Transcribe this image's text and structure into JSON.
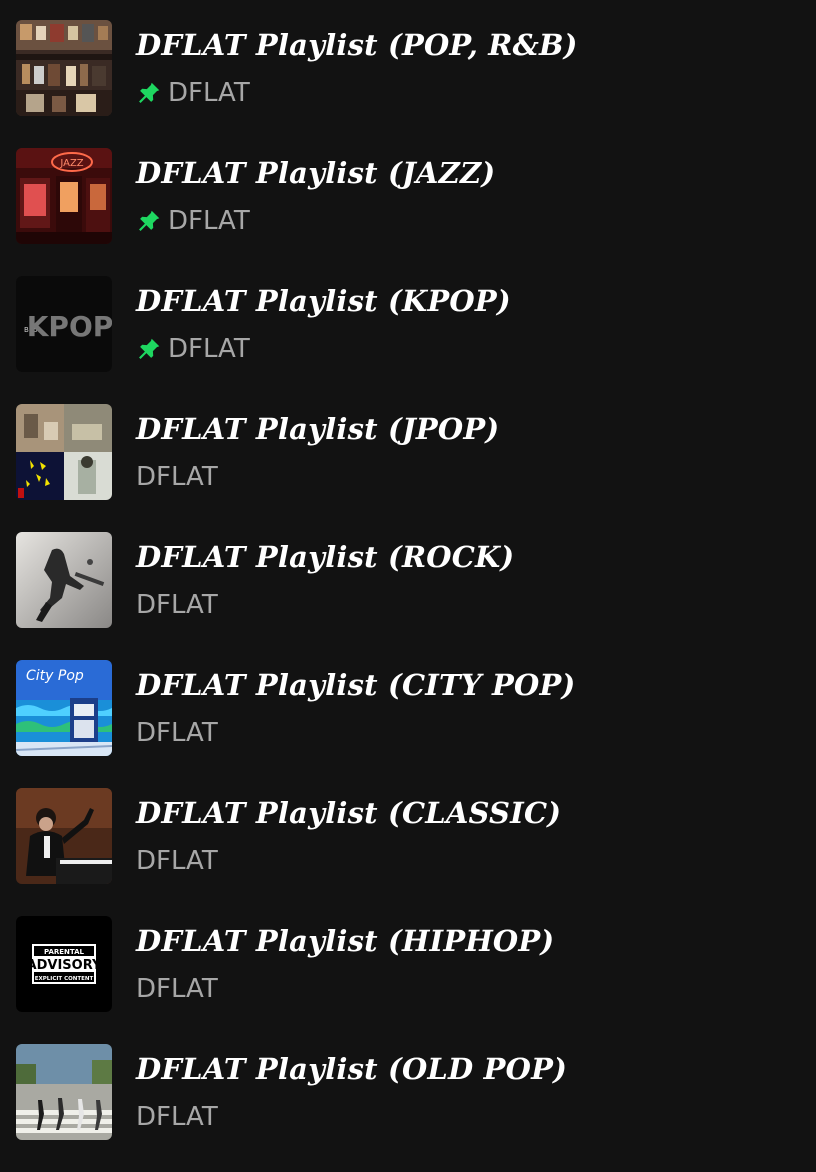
{
  "colors": {
    "background": "#121212",
    "title": "#ffffff",
    "subtitle": "#a7a7a7",
    "pin": "#1ed760"
  },
  "playlists": [
    {
      "title": "DFLAT Playlist (POP, R&B)",
      "owner": "DFLAT",
      "pinned": true,
      "cover_icon": "record-store-cover"
    },
    {
      "title": "DFLAT Playlist (JAZZ)",
      "owner": "DFLAT",
      "pinned": true,
      "cover_icon": "jazz-bar-cover",
      "cover_text": "JAZZ"
    },
    {
      "title": "DFLAT Playlist (KPOP)",
      "owner": "DFLAT",
      "pinned": true,
      "cover_icon": "kpop-text-cover",
      "cover_text": "KPOP",
      "cover_subtext": "B15"
    },
    {
      "title": "DFLAT Playlist (JPOP)",
      "owner": "DFLAT",
      "pinned": false,
      "cover_icon": "jpop-collage-cover"
    },
    {
      "title": "DFLAT Playlist (ROCK)",
      "owner": "DFLAT",
      "pinned": false,
      "cover_icon": "rock-guitarist-cover"
    },
    {
      "title": "DFLAT Playlist (CITY POP)",
      "owner": "DFLAT",
      "pinned": false,
      "cover_icon": "city-pop-cover",
      "cover_text": "City Pop"
    },
    {
      "title": "DFLAT Playlist (CLASSIC)",
      "owner": "DFLAT",
      "pinned": false,
      "cover_icon": "pianist-cover"
    },
    {
      "title": "DFLAT Playlist (HIPHOP)",
      "owner": "DFLAT",
      "pinned": false,
      "cover_icon": "parental-advisory-cover",
      "cover_text": [
        "PARENTAL",
        "ADVISORY",
        "EXPLICIT CONTENT"
      ]
    },
    {
      "title": "DFLAT Playlist (OLD POP)",
      "owner": "DFLAT",
      "pinned": false,
      "cover_icon": "crosswalk-cover"
    }
  ]
}
